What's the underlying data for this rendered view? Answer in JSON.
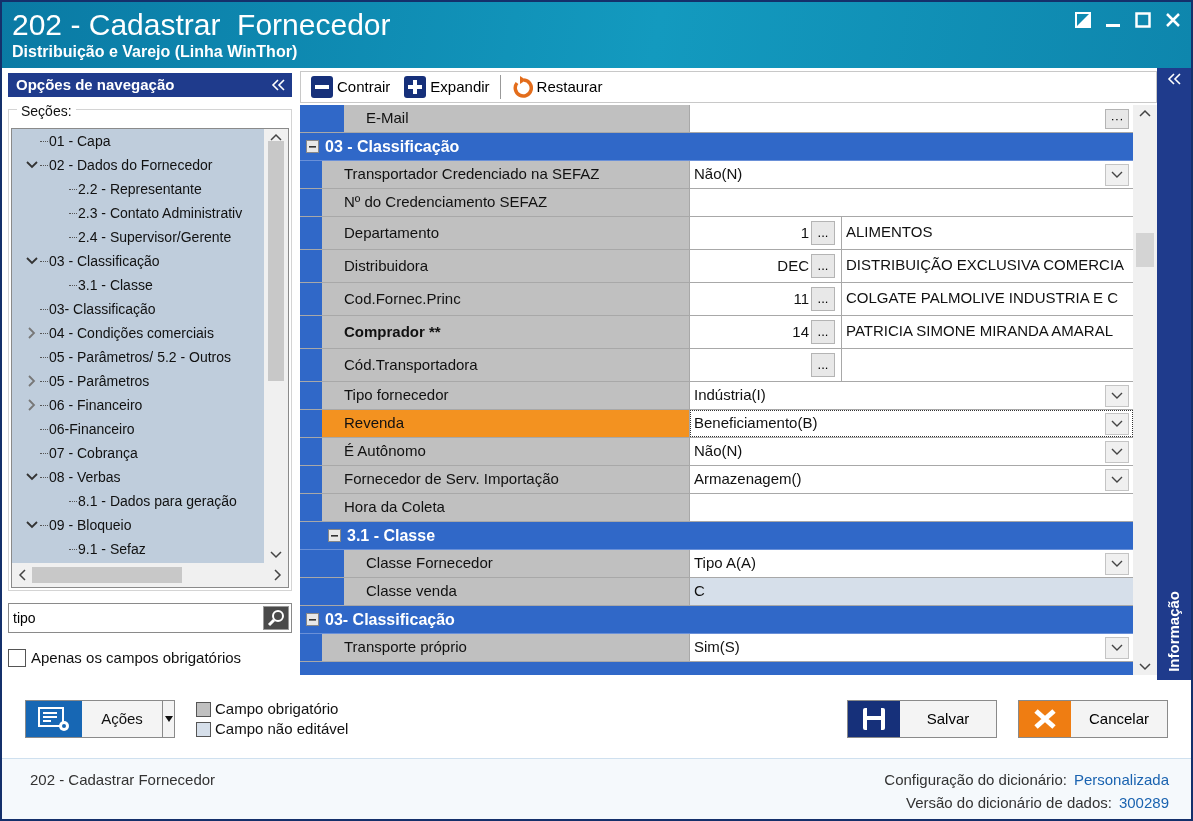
{
  "window": {
    "title": "202 - Cadastrar  Fornecedor",
    "subtitle": "Distribuição e Varejo (Linha WinThor)"
  },
  "navigation": {
    "title": "Opções de navegação",
    "sections_label": "Seções:",
    "tree": [
      {
        "label": "01 - Capa"
      },
      {
        "label": "02 - Dados do Fornecedor",
        "expanded": true,
        "children": [
          {
            "label": "2.2 - Representante"
          },
          {
            "label": "2.3 - Contato Administrativ"
          },
          {
            "label": "2.4 - Supervisor/Gerente"
          }
        ]
      },
      {
        "label": "03 - Classificação",
        "expanded": true,
        "children": [
          {
            "label": "3.1 - Classe"
          }
        ]
      },
      {
        "label": "03- Classificação"
      },
      {
        "label": "04 - Condições comerciais",
        "expanded": false
      },
      {
        "label": "05 - Parâmetros/ 5.2 - Outros"
      },
      {
        "label": "05 - Parâmetros",
        "expanded": false
      },
      {
        "label": "06 - Financeiro",
        "expanded": false
      },
      {
        "label": "06-Financeiro"
      },
      {
        "label": "07 - Cobrança"
      },
      {
        "label": "08 - Verbas",
        "expanded": true,
        "children": [
          {
            "label": "8.1 - Dados para geração"
          }
        ]
      },
      {
        "label": "09 - Bloqueio",
        "expanded": true,
        "children": [
          {
            "label": "9.1 - Sefaz"
          }
        ]
      }
    ],
    "search": {
      "value": "tipo"
    },
    "required_only": {
      "label": "Apenas os campos obrigatórios",
      "checked": false
    }
  },
  "toolbar": [
    {
      "kind": "collapse",
      "label": "Contrair"
    },
    {
      "kind": "expand",
      "label": "Expandir"
    },
    {
      "kind": "restore",
      "label": "Restaurar"
    }
  ],
  "grid": {
    "items": [
      {
        "kind": "group",
        "children": [
          {
            "kind": "group",
            "children": [
              {
                "kind": "text_button",
                "label": "E-Mail",
                "required": false,
                "selected": false,
                "button": "···"
              }
            ]
          }
        ]
      },
      {
        "kind": "group",
        "title": "03 - Classificação",
        "expanded": true,
        "children": [
          {
            "kind": "dropdown",
            "label": "Transportador Credenciado na SEFAZ",
            "required": false,
            "selected": false,
            "value": "Não(N)"
          },
          {
            "kind": "text",
            "label": "Nº do Credenciamento SEFAZ",
            "required": false,
            "selected": false
          },
          {
            "kind": "lookup",
            "label": "Departamento",
            "required": false,
            "selected": false,
            "code": "1",
            "button": "...",
            "description": "ALIMENTOS"
          },
          {
            "kind": "lookup",
            "label": "Distribuidora",
            "required": false,
            "selected": false,
            "code": "DEC",
            "button": "...",
            "description": "DISTRIBUIÇÃO EXCLUSIVA COMERCIA"
          },
          {
            "kind": "lookup",
            "label": "Cod.Fornec.Princ",
            "required": false,
            "selected": false,
            "code": "11",
            "button": "...",
            "description": "COLGATE PALMOLIVE INDUSTRIA  E C"
          },
          {
            "kind": "lookup",
            "label": "Comprador **",
            "required": true,
            "selected": false,
            "code": "14",
            "button": "...",
            "description": "PATRICIA SIMONE MIRANDA AMARAL"
          },
          {
            "kind": "lookup",
            "label": "Cód.Transportadora",
            "required": false,
            "selected": false,
            "button": "..."
          },
          {
            "kind": "dropdown",
            "label": "Tipo fornecedor",
            "required": false,
            "selected": false,
            "value": "Indústria(I)"
          },
          {
            "kind": "dropdown",
            "label": "Revenda",
            "required": false,
            "selected": true,
            "value": "Beneficiamento(B)"
          },
          {
            "kind": "dropdown",
            "label": "É Autônomo",
            "required": false,
            "selected": false,
            "value": "Não(N)"
          },
          {
            "kind": "dropdown",
            "label": "Fornecedor de Serv. Importação",
            "required": false,
            "selected": false,
            "value": "Armazenagem()"
          },
          {
            "kind": "text",
            "label": "Hora da Coleta",
            "required": false,
            "selected": false
          },
          {
            "kind": "group",
            "title": "3.1 - Classe",
            "expanded": true,
            "children": [
              {
                "kind": "dropdown",
                "label": "Classe Fornecedor",
                "required": false,
                "selected": false,
                "value": "Tipo A(A)"
              },
              {
                "kind": "readonly",
                "label": "Classe venda",
                "required": false,
                "selected": false,
                "value": "C"
              }
            ]
          }
        ]
      },
      {
        "kind": "group",
        "title": "03- Classificação",
        "expanded": true,
        "children": [
          {
            "kind": "dropdown",
            "label": "Transporte próprio",
            "required": false,
            "selected": false,
            "value": "Sim(S)"
          }
        ]
      },
      {
        "kind": "partial_group"
      }
    ]
  },
  "info_panel": {
    "title": "Informação"
  },
  "actions": {
    "label": "Ações"
  },
  "legend": [
    {
      "kind": "required",
      "label": "Campo obrigatório"
    },
    {
      "kind": "readonly",
      "label": "Campo não editável"
    }
  ],
  "buttons": [
    {
      "kind": "save",
      "label": "Salvar"
    },
    {
      "kind": "cancel",
      "label": "Cancelar"
    }
  ],
  "status_bar": {
    "form": "202 - Cadastrar  Fornecedor",
    "details": [
      {
        "label": "Configuração do dicionário:",
        "value": "Personalizada"
      },
      {
        "label": "Versão do dicionário de dados:",
        "value": "300289"
      }
    ]
  }
}
